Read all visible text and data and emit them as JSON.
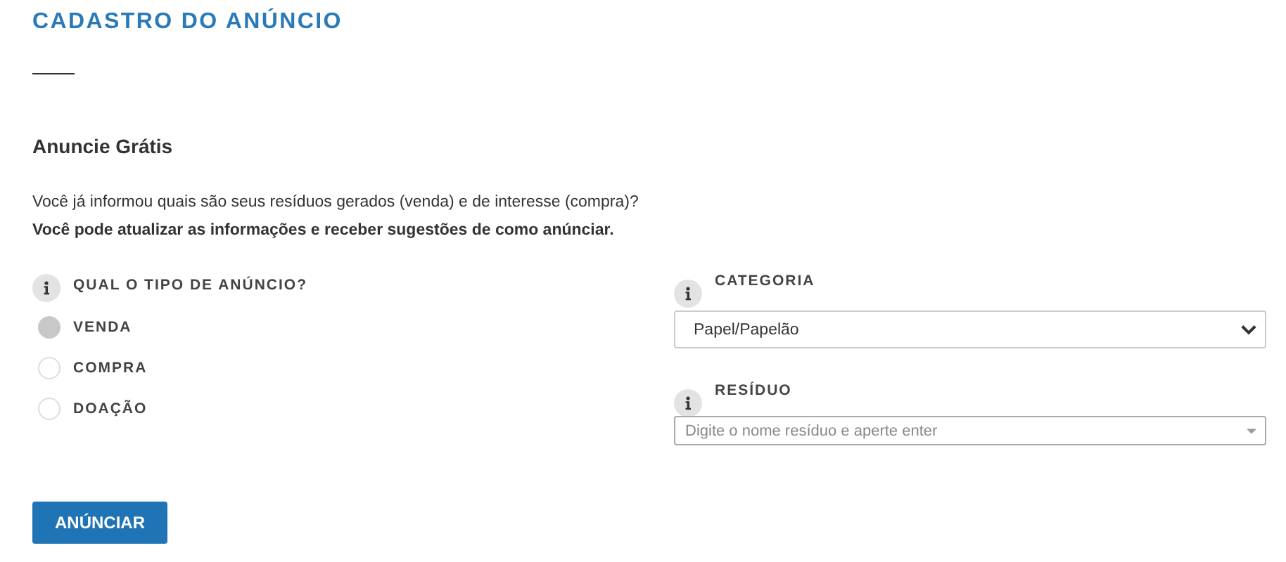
{
  "title": "CADASTRO DO ANÚNCIO",
  "heading": "Anuncie Grátis",
  "intro": [
    "Você já informou quais são seus resíduos gerados (venda) e de interesse (compra)?",
    "Você pode atualizar as informações e receber sugestões de como anúnciar."
  ],
  "ad_type": {
    "label": "QUAL O TIPO DE ANÚNCIO?",
    "options": [
      {
        "label": "VENDA",
        "selected": true
      },
      {
        "label": "COMPRA",
        "selected": false
      },
      {
        "label": "DOAÇÃO",
        "selected": false
      }
    ]
  },
  "category": {
    "label": "CATEGORIA",
    "value": "Papel/Papelão"
  },
  "residue": {
    "label": "RESÍDUO",
    "placeholder": "Digite o nome resíduo e aperte enter"
  },
  "submit": "ANÚNCIAR"
}
